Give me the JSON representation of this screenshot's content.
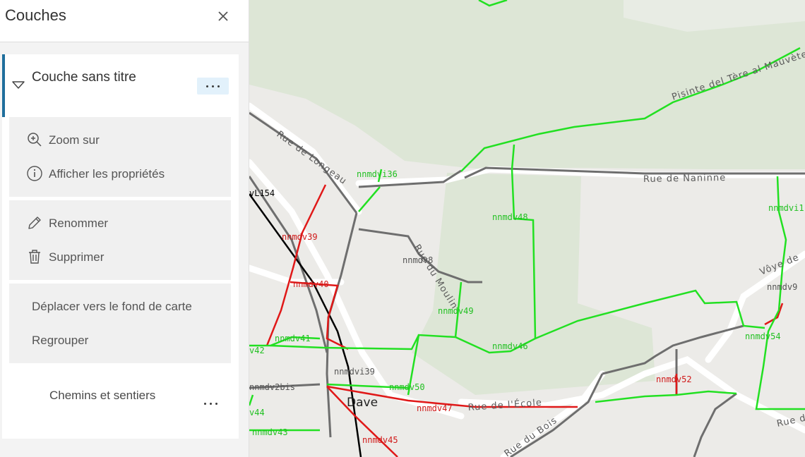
{
  "panel": {
    "title": "Couches",
    "close_icon": "close-icon",
    "layer": {
      "name": "Couche sans titre",
      "more_icon": "ellipsis-icon"
    },
    "menu": {
      "zoom_label": "Zoom sur",
      "properties_label": "Afficher les propriétés",
      "rename_label": "Renommer",
      "delete_label": "Supprimer",
      "move_basemap_label": "Déplacer vers le fond de carte",
      "group_label": "Regrouper"
    },
    "sublayer": {
      "name": "Chemins et sentiers",
      "more_icon": "ellipsis-icon"
    },
    "colors": {
      "accent": "#1f6e9c",
      "more_button_bg": "#e2f1fb"
    }
  },
  "map": {
    "colors": {
      "green": "#22e022",
      "red": "#e01818",
      "black": "#000000",
      "gray": "#6e6e6e",
      "park": "#d9e3cf"
    },
    "roads": {
      "longeau": "Rue de Longeau",
      "naninne": "Rue de Naninne",
      "pisinte": "Pisinte del Tère al Mauvète",
      "moulin": "Rue du Moulin",
      "ecole": "Rue de l'École",
      "bois": "Rue du Bois",
      "voye": "Vôye de",
      "rue_edge": "Rue de"
    },
    "places": {
      "dave": "Dave"
    },
    "labels": {
      "l_vl154": "vL154",
      "l_nnmdvi36": "nnmdvi36",
      "l_nnmdv48": "nnmdv48",
      "l_nnmdv39": "nnmdv39",
      "l_nnmdv8": "nnmdv8",
      "l_nnmdv40": "nnmdv40",
      "l_nnmdv49": "nnmdv49",
      "l_nnmdv46": "nnmdv46",
      "l_nnmdv41": "nnmdv41",
      "l_v42": "v42",
      "l_nnmdvi39": "nnmdvi39",
      "l_nnmdv2bis": "nnmdv2bis",
      "l_nnmdv50": "nnmdv50",
      "l_nnmdv47": "nnmdv47",
      "l_v44": "v44",
      "l_nnmdv43": "nnmdv43",
      "l_nnmdv45": "nnmdv45",
      "l_nnmdv52": "nnmdv52",
      "l_nnmdv54": "nnmdv54",
      "l_nnmdv9": "nnmdv9",
      "l_nnmdvi_edge": "nnmdvi1"
    }
  }
}
